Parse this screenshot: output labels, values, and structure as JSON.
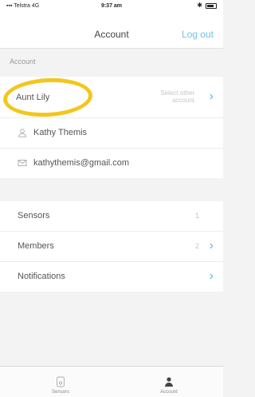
{
  "status_bar": {
    "carrier": "Telstra",
    "network": "4G",
    "time": "9:37 am"
  },
  "nav": {
    "title": "Account",
    "action": "Log out"
  },
  "account_section": {
    "header": "Account",
    "account_name": "Aunt Lily",
    "select_other_line1": "Select other",
    "select_other_line2": "account",
    "user_name": "Kathy Themis",
    "email": "kathythemis@gmail.com"
  },
  "settings": {
    "sensors_label": "Sensors",
    "sensors_count": "1",
    "members_label": "Members",
    "members_count": "2",
    "notifications_label": "Notifications"
  },
  "tabbar": {
    "sensors_tab": "Sensors",
    "account_tab": "Account"
  },
  "colors": {
    "accent": "#5bb7e6",
    "highlight": "#f3c61c"
  }
}
